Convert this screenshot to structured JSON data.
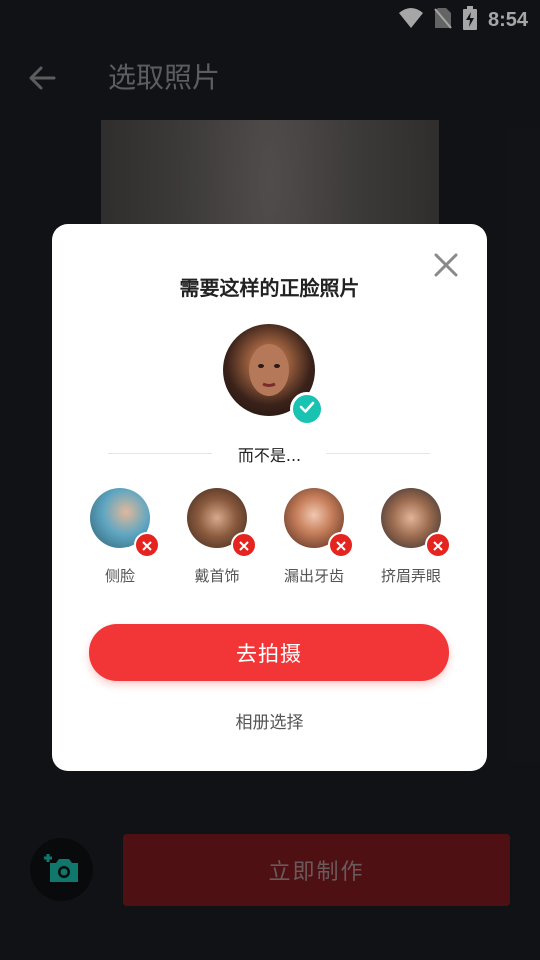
{
  "status_bar": {
    "time": "8:54"
  },
  "header": {
    "title": "选取照片"
  },
  "bottom": {
    "make_label": "立即制作"
  },
  "dialog": {
    "title": "需要这样的正脸照片",
    "divider_text": "而不是...",
    "bad_examples": [
      {
        "label": "侧脸"
      },
      {
        "label": "戴首饰"
      },
      {
        "label": "漏出牙齿"
      },
      {
        "label": "挤眉弄眼"
      }
    ],
    "primary_button": "去拍摄",
    "secondary_link": "相册选择"
  },
  "colors": {
    "background": "#1b1d23",
    "primary": "#f23638",
    "check": "#18c3b2",
    "error": "#e5231f",
    "camera_icon": "#18b7a5"
  },
  "icons": [
    "wifi-icon",
    "no-sim-icon",
    "battery-charging-icon",
    "back-arrow-icon",
    "close-icon",
    "check-icon",
    "x-icon",
    "add-camera-icon"
  ]
}
